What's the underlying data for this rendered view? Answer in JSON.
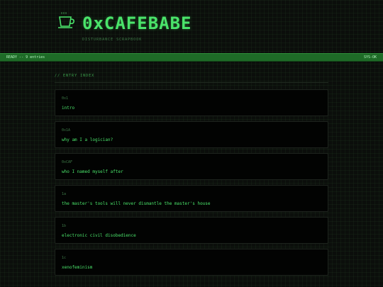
{
  "header": {
    "title": "0xCAFEBABE",
    "subtitle": "DISTURBANCE SCRAPBOOK",
    "logo_icon": "coffee-cup-icon"
  },
  "status_bar": {
    "left": "READY -- 9 entries",
    "right": "SYS-OK"
  },
  "section": {
    "title": "// ENTRY INDEX"
  },
  "entries": [
    {
      "id": "0x1",
      "title": "intro"
    },
    {
      "id": "0x1A",
      "title": "why am I a logician?"
    },
    {
      "id": "0xCAF",
      "title": "who I named myself after"
    },
    {
      "id": "1a",
      "title": "the master's tools will never dismantle the master's house"
    },
    {
      "id": "1b",
      "title": "electronic civil disobedience"
    },
    {
      "id": "1c",
      "title": "xenofeminism"
    }
  ],
  "colors": {
    "accent": "#4ae36a",
    "status_bar": "#1e6b27",
    "background": "#0b0e0b",
    "card": "#020302"
  }
}
